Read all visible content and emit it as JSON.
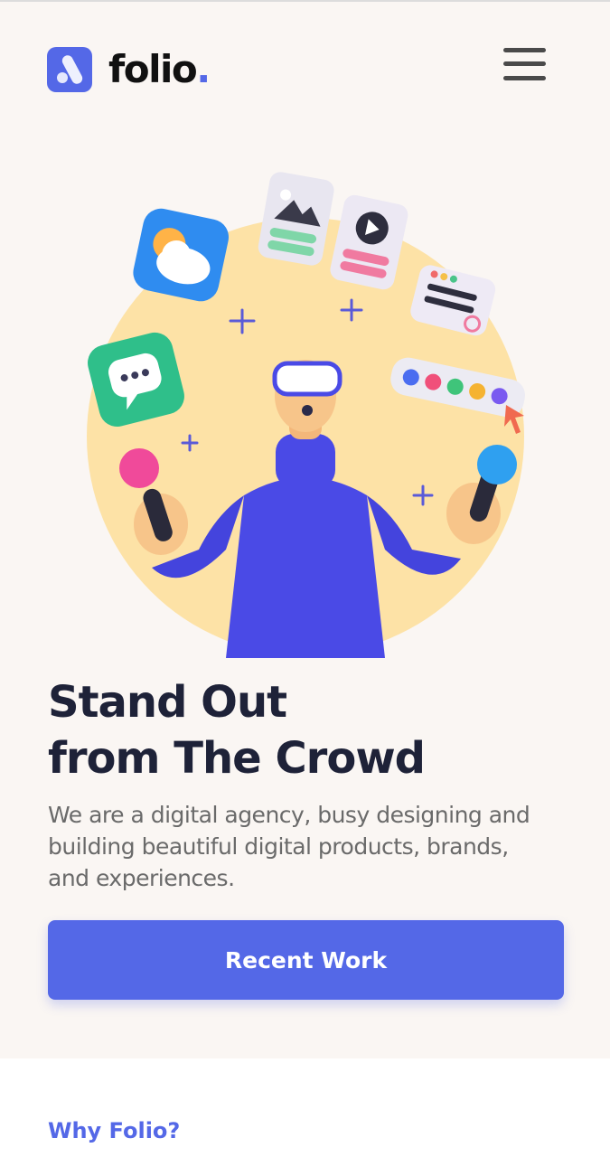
{
  "brand": {
    "name": "folio",
    "dot": ".",
    "accent_color": "#5468e7"
  },
  "header": {
    "menu_icon": "hamburger-menu-icon"
  },
  "hero": {
    "title_line1": "Stand Out",
    "title_line2": "from The Crowd",
    "description": "We are a digital agency, busy designing and building beautiful digital products, brands, and experiences.",
    "cta_label": "Recent Work",
    "background_color": "#faf6f3",
    "illustration_circle_color": "#fde2a6"
  },
  "section_next": {
    "label": "Why Folio?"
  }
}
